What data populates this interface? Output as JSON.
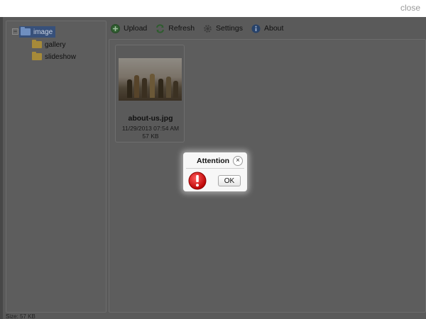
{
  "topbar": {
    "close_label": "close"
  },
  "tree": {
    "root": {
      "label": "image",
      "toggle": "−"
    },
    "children": [
      {
        "label": "gallery"
      },
      {
        "label": "slideshow"
      }
    ]
  },
  "toolbar": {
    "upload": "Upload",
    "refresh": "Refresh",
    "settings": "Settings",
    "about": "About"
  },
  "files": [
    {
      "name": "about-us.jpg",
      "date": "11/29/2013 07:54 AM",
      "size": "57 KB"
    }
  ],
  "status": {
    "text": "Size: 57 KB"
  },
  "dialog": {
    "title": "Attention",
    "close_glyph": "×",
    "ok_label": "OK"
  },
  "colors": {
    "overlay": "#5a5a5a",
    "selected": "#37507a",
    "folder": "#a68a39",
    "error": "#d10000"
  }
}
